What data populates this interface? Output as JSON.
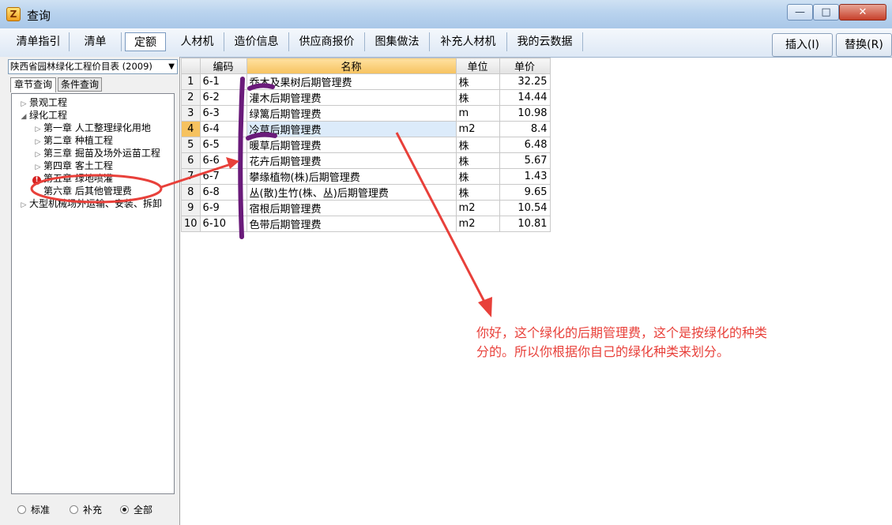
{
  "window": {
    "title": "查询",
    "icon_char": "Z",
    "min_label": "—",
    "max_label": "□",
    "close_label": "✕"
  },
  "tabs": [
    "清单指引",
    "清单",
    "定额",
    "人材机",
    "造价信息",
    "供应商报价",
    "图集做法",
    "补充人材机",
    "我的云数据"
  ],
  "active_tab": "定额",
  "actions": {
    "insert_label": "插入(I)",
    "replace_label": "替换(R)"
  },
  "left_panel": {
    "catalog_selected": "陕西省园林绿化工程价目表 (2009)",
    "subtabs": [
      "章节查询",
      "条件查询"
    ],
    "tree": [
      {
        "label": "景观工程"
      },
      {
        "label": "绿化工程"
      },
      {
        "label": "第一章 人工整理绿化用地"
      },
      {
        "label": "第二章 种植工程"
      },
      {
        "label": "第三章 掘苗及场外运苗工程"
      },
      {
        "label": "第四章 客土工程"
      },
      {
        "label": "第五章 绿地喷灌"
      },
      {
        "label": "第六章 后其他管理费"
      },
      {
        "label": "大型机械场外运输、安装、拆卸"
      }
    ],
    "radio_options": [
      "标准",
      "补充",
      "全部"
    ],
    "radio_selected": "全部"
  },
  "grid": {
    "headers": [
      "编码",
      "名称",
      "单位",
      "单价"
    ],
    "selected_row": 4,
    "rows": [
      {
        "no": "1",
        "code": "6-1",
        "name": "乔木及果树后期管理费",
        "unit": "株",
        "price": "32.25"
      },
      {
        "no": "2",
        "code": "6-2",
        "name": "灌木后期管理费",
        "unit": "株",
        "price": "14.44"
      },
      {
        "no": "3",
        "code": "6-3",
        "name": "绿篱后期管理费",
        "unit": "m",
        "price": "10.98"
      },
      {
        "no": "4",
        "code": "6-4",
        "name": "冷草后期管理费",
        "unit": "m2",
        "price": "8.4"
      },
      {
        "no": "5",
        "code": "6-5",
        "name": "暖草后期管理费",
        "unit": "株",
        "price": "6.48"
      },
      {
        "no": "6",
        "code": "6-6",
        "name": "花卉后期管理费",
        "unit": "株",
        "price": "5.67"
      },
      {
        "no": "7",
        "code": "6-7",
        "name": "攀缘植物(株)后期管理费",
        "unit": "株",
        "price": "1.43"
      },
      {
        "no": "8",
        "code": "6-8",
        "name": "丛(散)生竹(株、丛)后期管理费",
        "unit": "株",
        "price": "9.65"
      },
      {
        "no": "9",
        "code": "6-9",
        "name": "宿根后期管理费",
        "unit": "m2",
        "price": "10.54"
      },
      {
        "no": "10",
        "code": "6-10",
        "name": "色带后期管理费",
        "unit": "m2",
        "price": "10.81"
      }
    ]
  },
  "annotation": {
    "note_line1": "你好，这个绿化的后期管理费，这个是按绿化的种类",
    "note_line2": "分的。所以你根据你自己的绿化种类来划分。",
    "red": "#e8403a",
    "purple": "#6a1b7a"
  }
}
